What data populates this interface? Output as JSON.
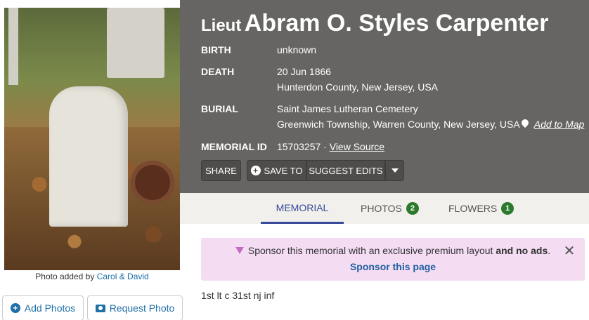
{
  "photo": {
    "caption_prefix": "Photo added by",
    "credit": "Carol & David"
  },
  "actions_left": {
    "add_photos": "Add Photos",
    "request_photo": "Request Photo"
  },
  "memorial": {
    "prefix": "Lieut",
    "name": "Abram O. Styles Carpenter",
    "birth_label": "BIRTH",
    "birth_value": "unknown",
    "death_label": "DEATH",
    "death_date": "20 Jun 1866",
    "death_place": "Hunterdon County, New Jersey, USA",
    "burial_label": "BURIAL",
    "burial_cemetery": "Saint James Lutheran Cemetery",
    "burial_place": "Greenwich Township, Warren County, New Jersey, USA",
    "add_to_map": "Add to Map",
    "id_label": "MEMORIAL ID",
    "id_value": "15703257 ·",
    "view_source": "View Source"
  },
  "header_buttons": {
    "share": "SHARE",
    "save_to": "SAVE TO",
    "suggest_edits": "SUGGEST EDITS"
  },
  "tabs": [
    {
      "label": "MEMORIAL",
      "active": true
    },
    {
      "label": "PHOTOS",
      "count": "2"
    },
    {
      "label": "FLOWERS",
      "count": "1"
    }
  ],
  "sponsor": {
    "text_main": "Sponsor this memorial with an exclusive premium layout",
    "text_bold": "and no ads",
    "text_end": ".",
    "link": "Sponsor this page"
  },
  "bio": "1st lt c 31st nj inf",
  "colors": {
    "header_bg": "#666563",
    "accent_blue": "#1f6fa8",
    "tab_active": "#3a4a9a",
    "badge_green": "#2b7a2b",
    "sponsor_bg": "#f4dcf3"
  }
}
